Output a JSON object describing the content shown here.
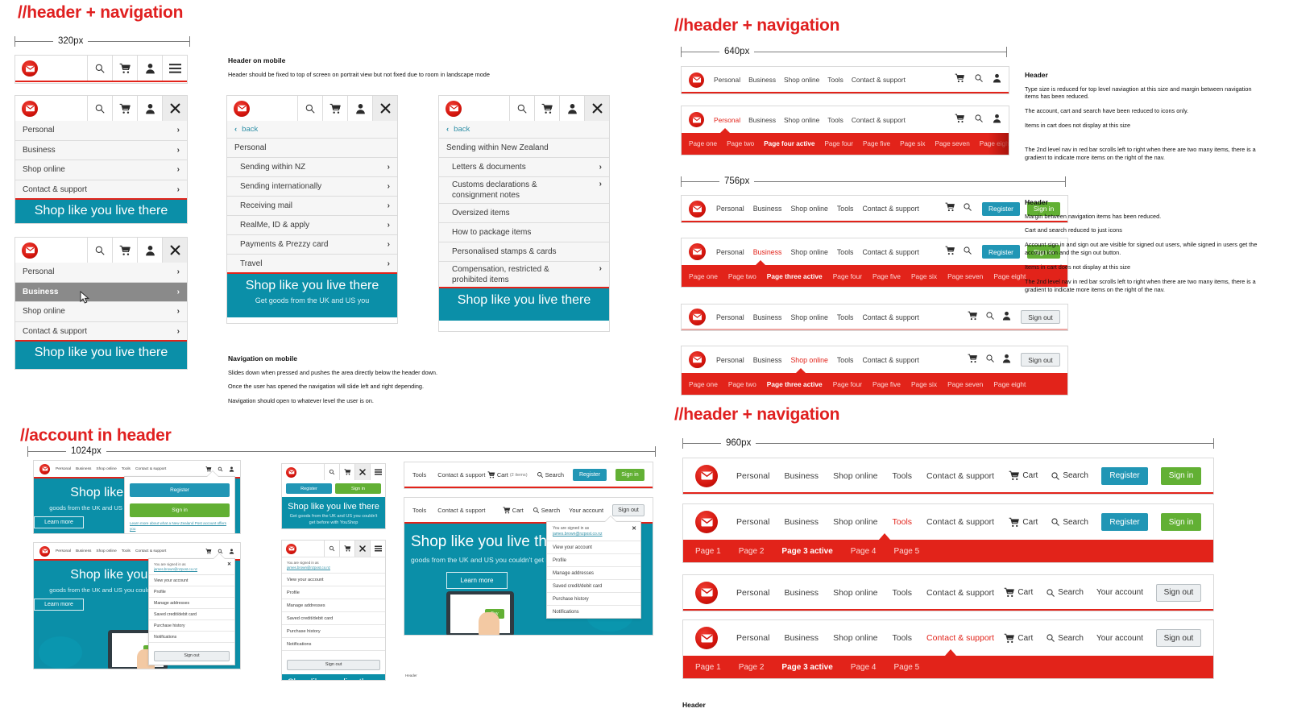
{
  "sections": {
    "mobile": {
      "title": "//header + navigation",
      "width_label": "320px"
    },
    "tablet": {
      "title": "//header + navigation",
      "width_640": "640px",
      "width_756": "756px"
    },
    "desktop": {
      "title": "//header + navigation",
      "width_label": "960px"
    },
    "account": {
      "title": "//account in header",
      "width_label": "1024px"
    }
  },
  "brand": {
    "logo_name": "nzpost-envelope-logo",
    "red": "#e2231a",
    "teal": "#0b8fa8",
    "register_blue": "#2196b5",
    "signin_green": "#62b034"
  },
  "primary_nav": [
    "Personal",
    "Business",
    "Shop online",
    "Tools",
    "Contact & support"
  ],
  "actions": {
    "cart": "Cart",
    "cart_with_count": "Cart",
    "cart_count": "(2 items)",
    "search": "Search",
    "register": "Register",
    "sign_in": "Sign in",
    "sign_out": "Sign out",
    "your_account": "Your account"
  },
  "mobile_menu": {
    "level1": [
      "Personal",
      "Business",
      "Shop online",
      "Contact & support"
    ],
    "hover_item": "Business",
    "back_label": "back",
    "panel2": {
      "heading": "Personal",
      "items": [
        "Sending within NZ",
        "Sending internationally",
        "Receiving mail",
        "RealMe, ID & apply",
        "Payments & Prezzy card",
        "Travel"
      ]
    },
    "panel3": {
      "heading": "Sending within New Zealand",
      "items": [
        {
          "label": "Letters & documents",
          "chevron": true
        },
        {
          "label": "Customs declarations & consignment notes",
          "chevron": true
        },
        {
          "label": "Oversized items",
          "chevron": false
        },
        {
          "label": "How to package items",
          "chevron": false
        },
        {
          "label": "Personalised stamps & cards",
          "chevron": false
        },
        {
          "label": "Compensation, restricted & prohibited items",
          "chevron": true
        }
      ]
    }
  },
  "promo": {
    "title": "Shop like you live there",
    "subtitle": "Get goods from the UK and US you couldn't get before with YouShop",
    "subtitle_short": "Get goods from the UK and US you",
    "subtitle_desktop": "goods from the UK and US you couldn't get before with YouShop",
    "button": "Learn more",
    "buy_label": "Buy"
  },
  "subnav": {
    "eight": [
      {
        "label": "Page one",
        "active": false
      },
      {
        "label": "Page two",
        "active": false
      },
      {
        "label": "Page four active",
        "active": true
      },
      {
        "label": "Page four",
        "active": false
      },
      {
        "label": "Page five",
        "active": false
      },
      {
        "label": "Page six",
        "active": false
      },
      {
        "label": "Page seven",
        "active": false
      },
      {
        "label": "Page eight",
        "active": false
      }
    ],
    "eight_three": [
      {
        "label": "Page one",
        "active": false
      },
      {
        "label": "Page two",
        "active": false
      },
      {
        "label": "Page three active",
        "active": true
      },
      {
        "label": "Page four",
        "active": false
      },
      {
        "label": "Page five",
        "active": false
      },
      {
        "label": "Page six",
        "active": false
      },
      {
        "label": "Page seven",
        "active": false
      },
      {
        "label": "Page eight",
        "active": false
      }
    ],
    "five": [
      {
        "label": "Page 1",
        "active": false
      },
      {
        "label": "Page 2",
        "active": false
      },
      {
        "label": "Page 3 active",
        "active": true
      },
      {
        "label": "Page 4",
        "active": false
      },
      {
        "label": "Page 5",
        "active": false
      }
    ]
  },
  "account_menu": {
    "signed_in_as": "You are signed in as",
    "email": "james.brown@nzpost.co.nz",
    "items": [
      "View your account",
      "Profile",
      "Manage addresses",
      "Saved credit/debit card",
      "Purchase history",
      "Notifications"
    ],
    "sign_out": "Sign out",
    "register": "Register",
    "sign_in": "Sign in",
    "learn_more_link": "Learn more about what a New Zealand Post account offers you",
    "close_label": "close"
  },
  "notes": {
    "mobile_header": {
      "heading": "Header on mobile",
      "lines": [
        "Header should be fixed to top of screen on portrait view but not fixed due to room in landscape mode"
      ]
    },
    "mobile_nav": {
      "heading": "Navigation on mobile",
      "lines": [
        "Slides down when pressed and pushes the area directly below the header down.",
        "Once the user has opened the navigation will slide left and right depending.",
        "Navigation should open to whatever level the user is on."
      ]
    },
    "header_640": {
      "heading": "Header",
      "lines": [
        "Type size is reduced for top level naviagtion at this size and margin between navigation items has been reduced.",
        "The account, cart and search have been reduced to icons only.",
        "Items in cart does not display at this size"
      ],
      "extra": "The 2nd level nav in red bar scrolls left to right when there are two many items, there is a gradient to indicate more items on the right of the nav."
    },
    "header_756": {
      "heading": "Header",
      "lines": [
        "Margin between navigation items has been reduced.",
        "Cart and search reduced to just icons",
        "Account sign in and sign out are visible for signed out users, while signed in users get the account icon and the sign out button.",
        "Items in cart does not display at this size",
        "The 2nd level nav in red bar scrolls left to right when there are two many items, there is a gradient to indicate more items on the right of the nav."
      ]
    },
    "header_960": {
      "heading": "Header"
    }
  }
}
